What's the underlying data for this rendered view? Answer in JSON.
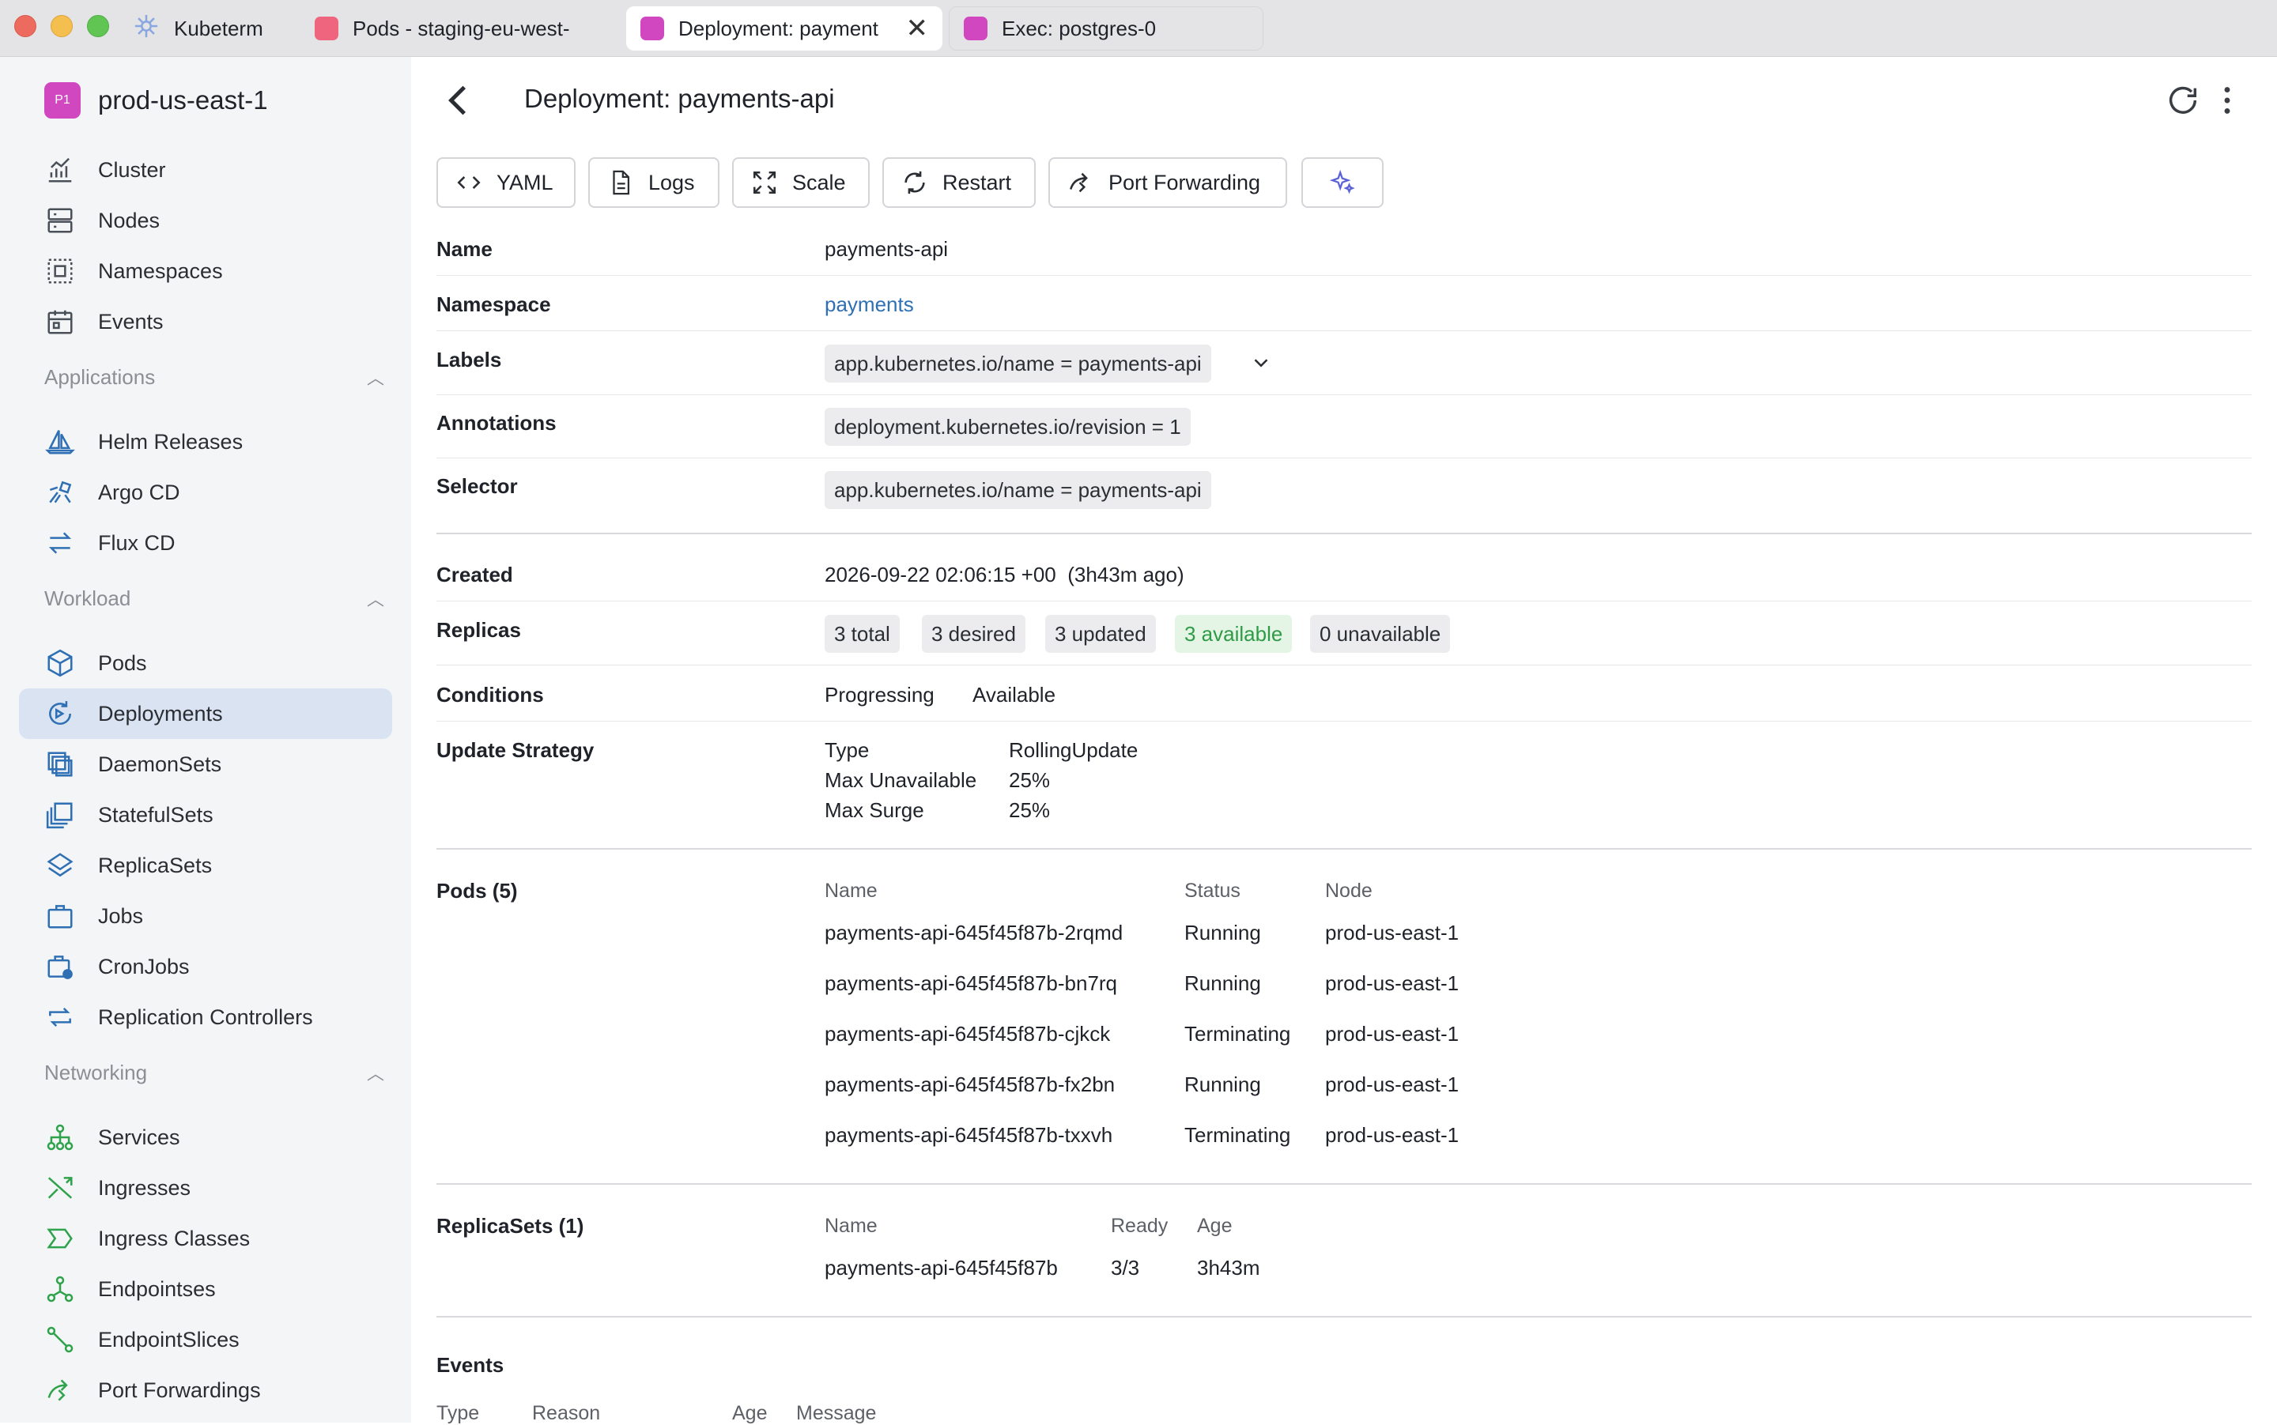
{
  "tabs": [
    {
      "label": "Kubeterm",
      "icon": "kubernetes-wheel-icon",
      "color": "#8aa8e0"
    },
    {
      "label": "Pods - staging-eu-west-",
      "icon": "cluster-square-icon",
      "color": "#f0657e"
    },
    {
      "label": "Deployment: payment",
      "icon": "cluster-square-icon",
      "color": "#d147c0"
    },
    {
      "label": "Exec: postgres-0",
      "icon": "cluster-square-icon",
      "color": "#d147c0"
    }
  ],
  "sidebar": {
    "cluster_badge": "P1",
    "cluster_name": "prod-us-east-1",
    "top_items": [
      {
        "label": "Cluster",
        "icon": "chart-icon"
      },
      {
        "label": "Nodes",
        "icon": "server-icon"
      },
      {
        "label": "Namespaces",
        "icon": "dotted-square-icon"
      },
      {
        "label": "Events",
        "icon": "calendar-icon"
      }
    ],
    "groups": [
      {
        "title": "Applications",
        "items": [
          {
            "label": "Helm Releases",
            "icon": "sailboat-icon"
          },
          {
            "label": "Argo CD",
            "icon": "octopus-icon"
          },
          {
            "label": "Flux CD",
            "icon": "arrows-swap-icon"
          }
        ]
      },
      {
        "title": "Workload",
        "items": [
          {
            "label": "Pods",
            "icon": "cube-icon"
          },
          {
            "label": "Deployments",
            "icon": "deployment-icon"
          },
          {
            "label": "DaemonSets",
            "icon": "daemonset-icon"
          },
          {
            "label": "StatefulSets",
            "icon": "statefulset-icon"
          },
          {
            "label": "ReplicaSets",
            "icon": "layers-icon"
          },
          {
            "label": "Jobs",
            "icon": "briefcase-icon"
          },
          {
            "label": "CronJobs",
            "icon": "cronjob-icon"
          },
          {
            "label": "Replication Controllers",
            "icon": "repeat-icon"
          }
        ]
      },
      {
        "title": "Networking",
        "items": [
          {
            "label": "Services",
            "icon": "network-icon"
          },
          {
            "label": "Ingresses",
            "icon": "shuffle-icon"
          },
          {
            "label": "Ingress Classes",
            "icon": "ingress-class-icon"
          },
          {
            "label": "Endpointses",
            "icon": "endpoints-icon"
          },
          {
            "label": "EndpointSlices",
            "icon": "endpoint-slice-icon"
          },
          {
            "label": "Port Forwardings",
            "icon": "port-forward-icon"
          }
        ]
      }
    ]
  },
  "header": {
    "title": "Deployment: payments-api",
    "back_icon": "chevron-left-icon"
  },
  "toolbar": {
    "yaml": "YAML",
    "logs": "Logs",
    "scale": "Scale",
    "restart": "Restart",
    "port_forwarding": "Port Forwarding"
  },
  "details": {
    "name_label": "Name",
    "name": "payments-api",
    "namespace_label": "Namespace",
    "namespace": "payments",
    "labels_label": "Labels",
    "labels": "app.kubernetes.io/name = payments-api",
    "annotations_label": "Annotations",
    "annotations": "deployment.kubernetes.io/revision = 1",
    "selector_label": "Selector",
    "selector": "app.kubernetes.io/name = payments-api",
    "created_label": "Created",
    "created": "2026-09-22 02:06:15 +00  (3h43m ago)",
    "replicas_label": "Replicas",
    "replicas": {
      "total": "3 total",
      "desired": "3 desired",
      "updated": "3 updated",
      "available": "3 available",
      "unavailable": "0 unavailable"
    },
    "conditions_label": "Conditions",
    "conditions": [
      "Progressing",
      "Available"
    ],
    "strategy_label": "Update Strategy",
    "strategy": [
      {
        "key": "Type",
        "value": "RollingUpdate"
      },
      {
        "key": "Max Unavailable",
        "value": "25%"
      },
      {
        "key": "Max Surge",
        "value": "25%"
      }
    ]
  },
  "pods": {
    "title": "Pods (5)",
    "headers": [
      "Name",
      "Status",
      "Node"
    ],
    "rows": [
      {
        "name": "payments-api-645f45f87b-2rqmd",
        "status": "Running",
        "node": "prod-us-east-1"
      },
      {
        "name": "payments-api-645f45f87b-bn7rq",
        "status": "Running",
        "node": "prod-us-east-1"
      },
      {
        "name": "payments-api-645f45f87b-cjkck",
        "status": "Terminating",
        "node": "prod-us-east-1"
      },
      {
        "name": "payments-api-645f45f87b-fx2bn",
        "status": "Running",
        "node": "prod-us-east-1"
      },
      {
        "name": "payments-api-645f45f87b-txxvh",
        "status": "Terminating",
        "node": "prod-us-east-1"
      }
    ]
  },
  "replicasets": {
    "title": "ReplicaSets (1)",
    "headers": [
      "Name",
      "Ready",
      "Age"
    ],
    "rows": [
      {
        "name": "payments-api-645f45f87b",
        "ready": "3/3",
        "age": "3h43m"
      }
    ]
  },
  "events": {
    "title": "Events",
    "headers": [
      "Type",
      "Reason",
      "Age",
      "Message"
    ]
  },
  "colors": {
    "running": "#2fa34b",
    "terminating": "#e39a1e",
    "link": "#2f6fb4",
    "selected": "#d9e3f2",
    "accent": "#2f6fb4"
  }
}
